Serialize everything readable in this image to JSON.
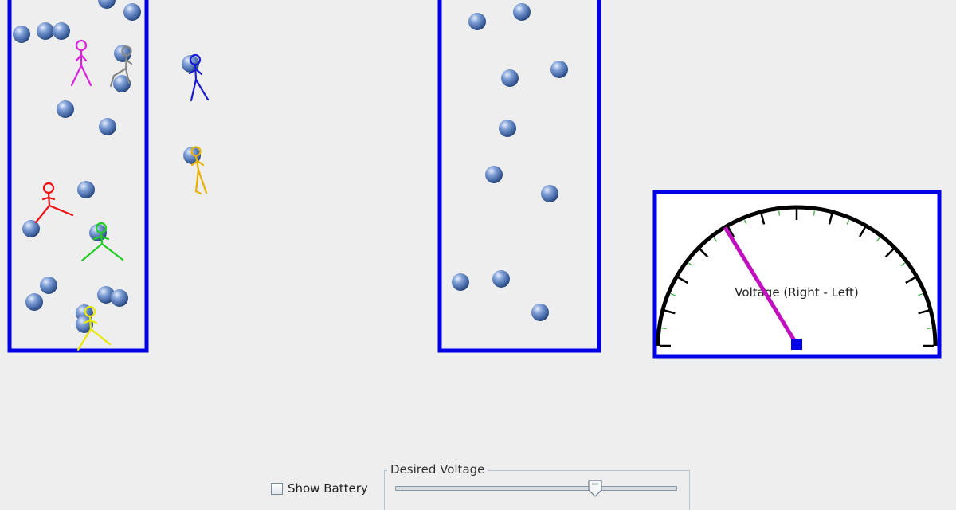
{
  "meter": {
    "label": "Voltage (Right - Left)",
    "needle_reading": -0.35
  },
  "controls": {
    "show_battery": {
      "label": "Show Battery",
      "checked": false
    },
    "desired_voltage": {
      "legend": "Desired Voltage",
      "value_fraction": 0.71
    }
  },
  "colors": {
    "background": "#eeeeee",
    "container_border": "#0000e8",
    "ball": "#4a6fb0",
    "needle": "#c010c0",
    "dial_arc": "#000000",
    "minor_tick": "#33aa33",
    "people": [
      "#dd22dd",
      "#888888",
      "#1a1ad0",
      "#e8c000",
      "#ee1111",
      "#22cc22",
      "#e8e800"
    ]
  }
}
